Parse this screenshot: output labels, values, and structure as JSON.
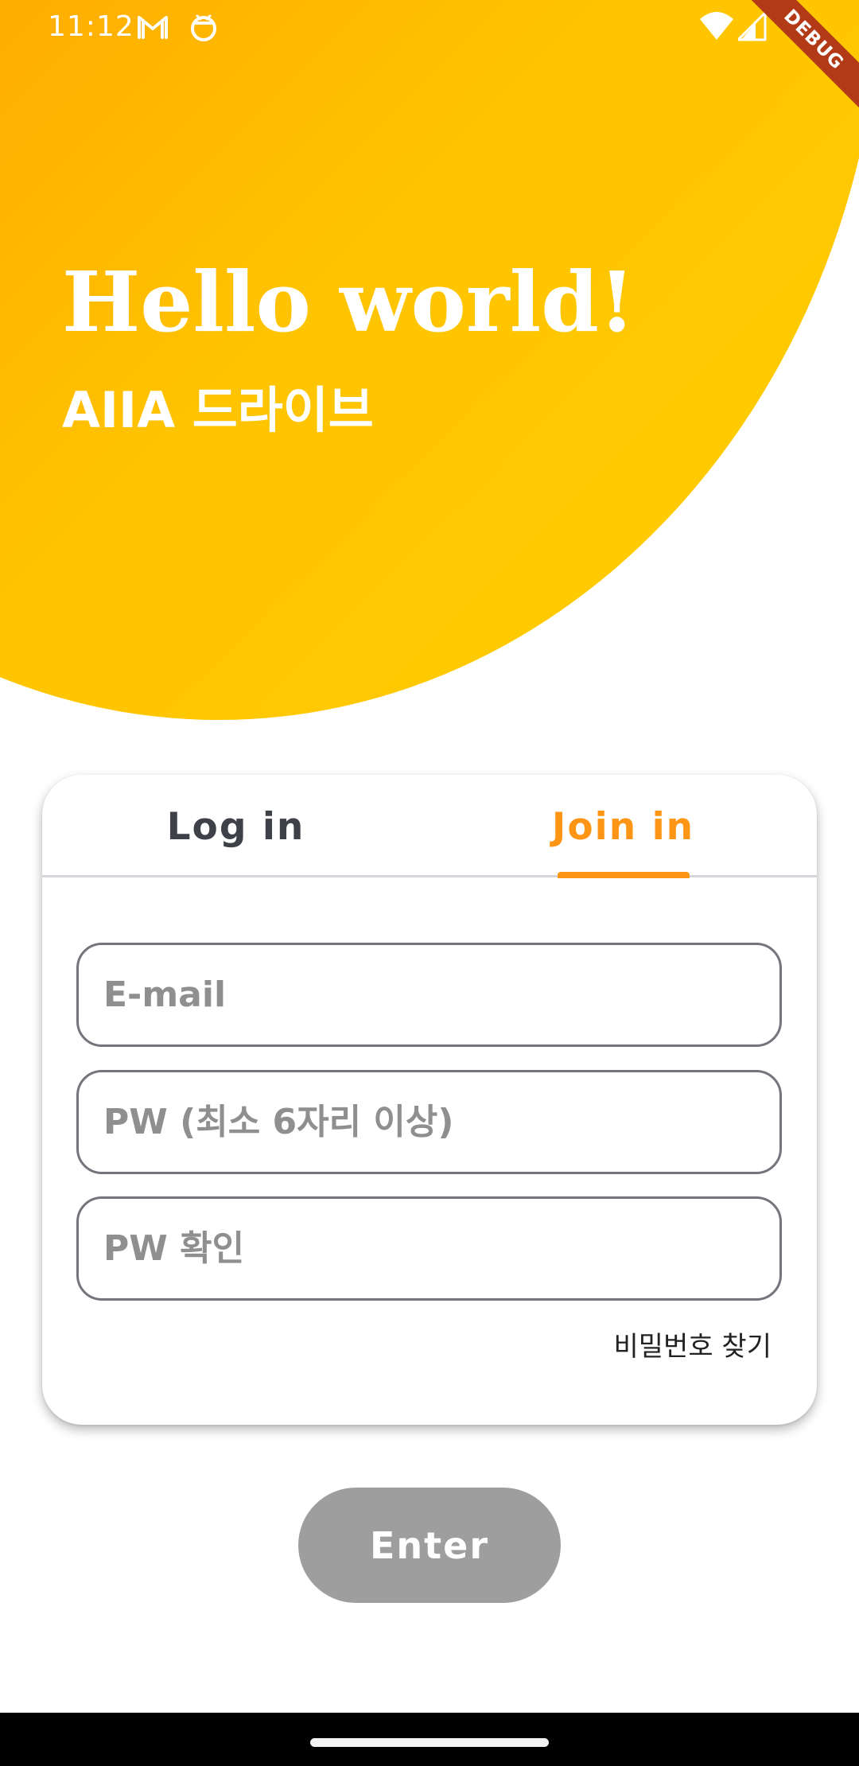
{
  "status_bar": {
    "time": "11:12",
    "left_icons": [
      "gmail-icon",
      "android-debug-icon"
    ],
    "right_icons": [
      "wifi-icon",
      "cellular-signal-icon"
    ]
  },
  "debug_banner": {
    "label": "DEBUG",
    "color": "#b23a17"
  },
  "hero": {
    "title": "Hello world!",
    "subtitle": "AIIA 드라이브",
    "gradient_colors": [
      "#ff8c00",
      "#ffa500",
      "#ffc400",
      "#ffce00"
    ]
  },
  "auth_card": {
    "tabs": [
      {
        "label": "Log in",
        "selected": false
      },
      {
        "label": "Join in",
        "selected": true
      }
    ],
    "fields": {
      "email": {
        "value": "",
        "placeholder": "E-mail"
      },
      "password": {
        "value": "",
        "placeholder": "PW (최소 6자리 이상)"
      },
      "password_confirm": {
        "value": "",
        "placeholder": "PW 확인"
      }
    },
    "find_password_label": "비밀번호 찾기"
  },
  "enter_button": {
    "label": "Enter",
    "enabled": false
  },
  "colors": {
    "accent": "#ff9514",
    "inactive_tab": "#3f4148",
    "button_disabled": "#9e9e9e",
    "field_border": "#74757c",
    "nav_bar": "#000000"
  }
}
